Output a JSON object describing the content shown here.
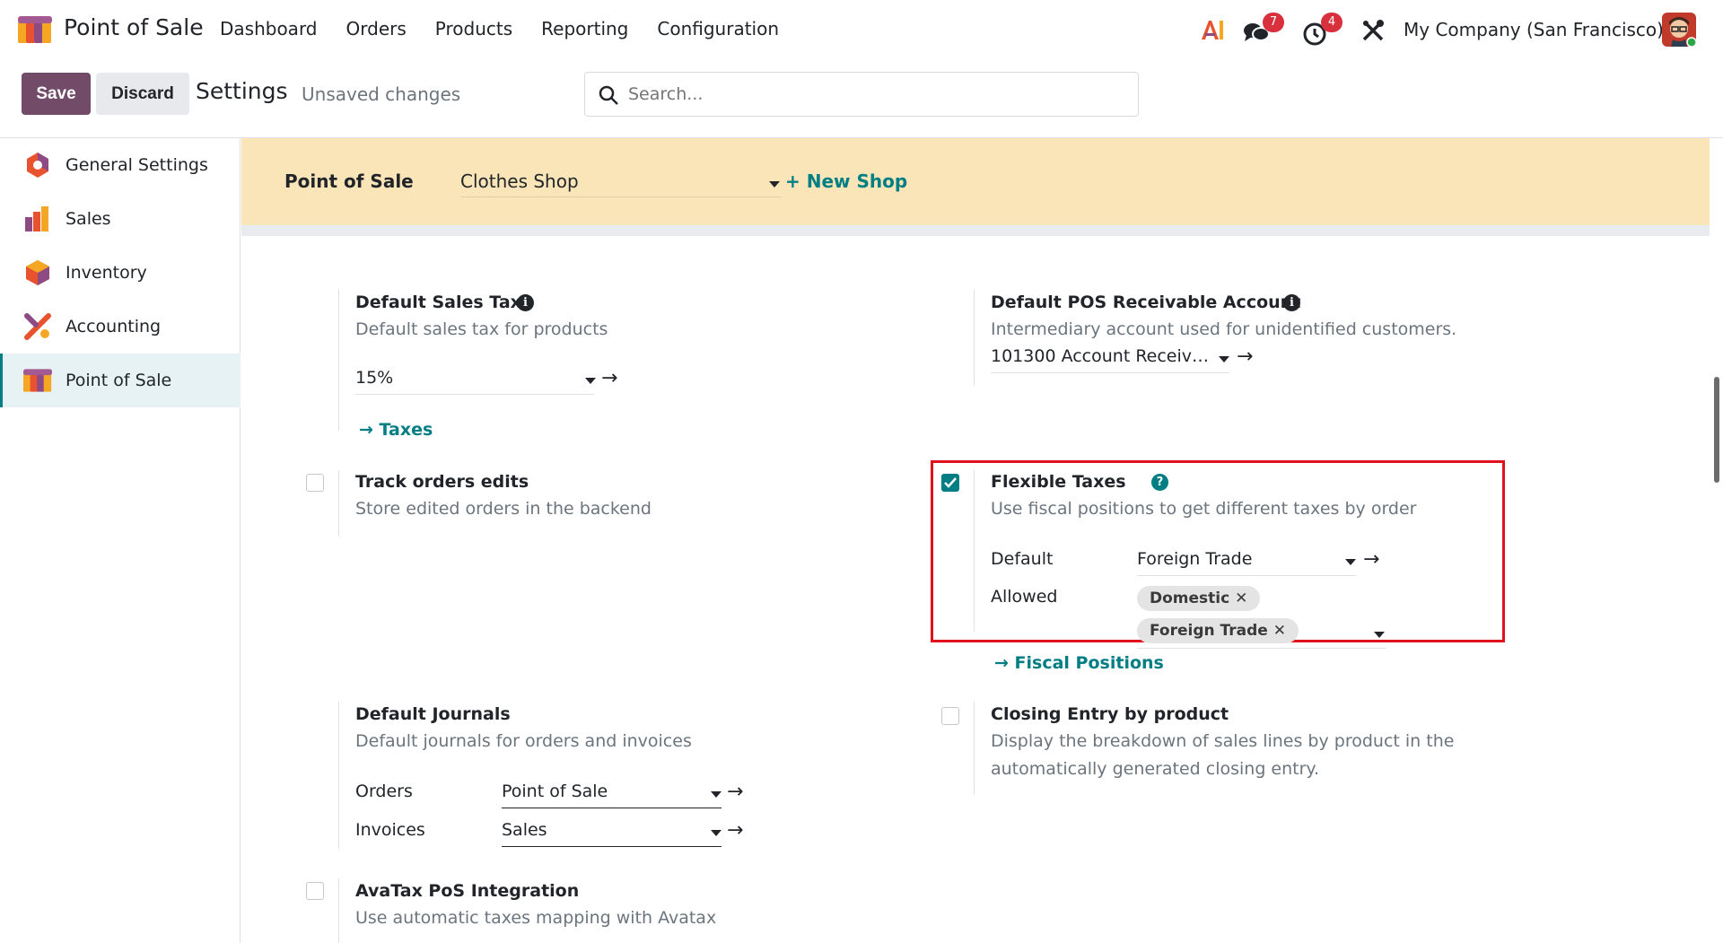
{
  "navbar": {
    "app_name": "Point of Sale",
    "menu": [
      "Dashboard",
      "Orders",
      "Products",
      "Reporting",
      "Configuration"
    ],
    "messages_count": "7",
    "activities_count": "4",
    "company": "My Company (San Francisco)"
  },
  "control": {
    "save_label": "Save",
    "discard_label": "Discard",
    "title": "Settings",
    "status": "Unsaved changes",
    "search_placeholder": "Search..."
  },
  "sidebar": {
    "items": [
      {
        "label": "General Settings",
        "icon": "general-settings-icon"
      },
      {
        "label": "Sales",
        "icon": "sales-icon"
      },
      {
        "label": "Inventory",
        "icon": "inventory-icon"
      },
      {
        "label": "Accounting",
        "icon": "accounting-icon"
      },
      {
        "label": "Point of Sale",
        "icon": "pos-icon",
        "active": true
      }
    ]
  },
  "banner": {
    "title": "Point of Sale",
    "shop": "Clothes Shop",
    "new_shop": "+ New Shop"
  },
  "settings": {
    "default_sales_tax": {
      "title": "Default Sales Tax",
      "desc": "Default sales tax for products",
      "value": "15%",
      "link": "Taxes"
    },
    "receivable_account": {
      "title": "Default POS Receivable Account",
      "desc": "Intermediary account used for unidentified customers.",
      "value": "101300 Account Receiv…"
    },
    "track_orders": {
      "title": "Track orders edits",
      "desc": "Store edited orders in the backend",
      "checked": false
    },
    "flexible_taxes": {
      "title": "Flexible Taxes",
      "desc": "Use fiscal positions to get different taxes by order",
      "checked": true,
      "default_label": "Default",
      "default_value": "Foreign Trade",
      "allowed_label": "Allowed",
      "tags": [
        "Domestic",
        "Foreign Trade"
      ],
      "link": "Fiscal Positions"
    },
    "default_journals": {
      "title": "Default Journals",
      "desc": "Default journals for orders and invoices",
      "orders_label": "Orders",
      "orders_value": "Point of Sale",
      "invoices_label": "Invoices",
      "invoices_value": "Sales"
    },
    "closing_entry": {
      "title": "Closing Entry by product",
      "desc_line1": "Display the breakdown of sales lines by product in the",
      "desc_line2": "automatically generated closing entry.",
      "checked": false
    },
    "avatax": {
      "title": "AvaTax PoS Integration",
      "desc": "Use automatic taxes mapping with Avatax",
      "checked": false
    }
  },
  "colors": {
    "primary": "#714b67",
    "accent": "#017e84",
    "banner": "#fae5b8",
    "badge": "#d9303e",
    "highlight": "#e0131d"
  }
}
